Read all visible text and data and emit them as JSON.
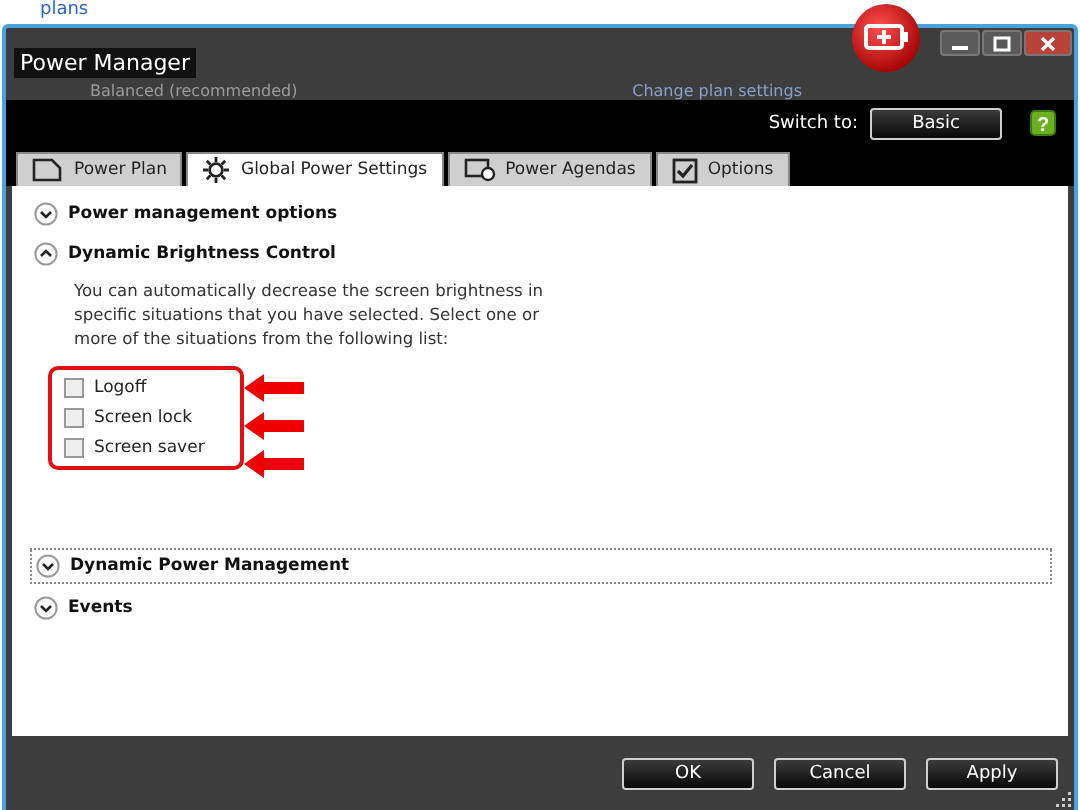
{
  "background_page": {
    "link": "plans"
  },
  "window": {
    "title": "Power Manager",
    "ghost_plan": "Balanced (recommended)",
    "ghost_link": "Change plan settings"
  },
  "toolbar": {
    "switch_label": "Switch to:",
    "switch_button": "Basic",
    "help_glyph": "?"
  },
  "tabs": [
    {
      "label": "Power Plan",
      "kind": "plan",
      "selected": false
    },
    {
      "label": "Global Power Settings",
      "kind": "gear",
      "selected": true
    },
    {
      "label": "Power Agendas",
      "kind": "agenda",
      "selected": false
    },
    {
      "label": "Options",
      "kind": "check",
      "selected": false
    }
  ],
  "sections": [
    {
      "title": "Power management options",
      "expanded": false,
      "focused": false
    },
    {
      "title": "Dynamic Brightness Control",
      "expanded": true,
      "focused": false,
      "description": "You can automatically decrease the screen brightness in specific situations that you have selected. Select one or more of the situations from the following list:",
      "options": [
        {
          "label": "Logoff",
          "checked": false
        },
        {
          "label": "Screen lock",
          "checked": false
        },
        {
          "label": "Screen saver",
          "checked": false
        }
      ]
    },
    {
      "title": "Dynamic Power Management",
      "expanded": false,
      "focused": true
    },
    {
      "title": "Events",
      "expanded": false,
      "focused": false
    }
  ],
  "buttons": [
    "OK",
    "Cancel",
    "Apply"
  ]
}
